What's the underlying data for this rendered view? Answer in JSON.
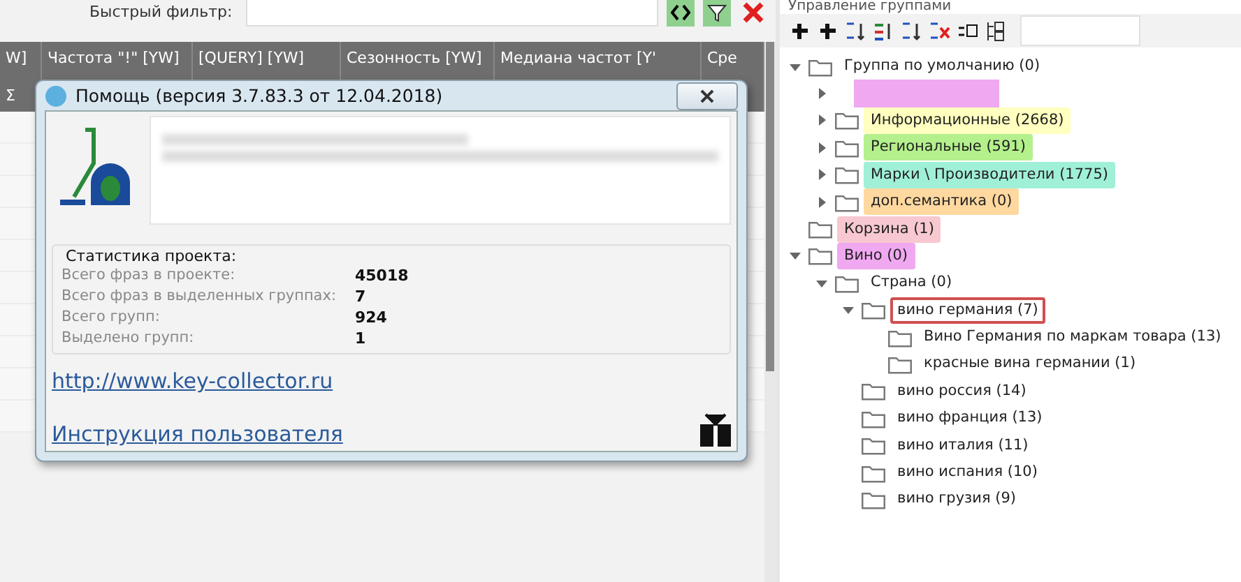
{
  "filter": {
    "label": "Быстрый фильтр:"
  },
  "grid": {
    "columns": [
      "W]",
      "Частота \"!\" [YW]",
      "[QUERY] [YW]",
      "Сезонность [YW]",
      "Медиана частот [Y'",
      "Сре"
    ],
    "sum_symbol": "Σ"
  },
  "dialog": {
    "title": "Помощь (версия 3.7.83.3 от 12.04.2018)",
    "stats_title": "Статистика проекта:",
    "stats": [
      {
        "label": "Всего фраз в проекте:",
        "value": "45018"
      },
      {
        "label": "Всего фраз в выделенных группах:",
        "value": "7"
      },
      {
        "label": "Всего групп:",
        "value": "924"
      },
      {
        "label": "Выделено групп:",
        "value": "1"
      }
    ],
    "links": [
      "http://www.key-collector.ru",
      "Инструкция пользователя"
    ]
  },
  "groups_panel": {
    "title": "Управление группами",
    "tree": [
      {
        "label": "Группа по умолчанию (0)",
        "expanded": true,
        "selected": false,
        "children": [
          {
            "kind": "blurred",
            "expanded": false,
            "selected": false,
            "color": "#f0a8f0"
          },
          {
            "label": "Информационные (2668)",
            "expanded": false,
            "selected": false,
            "color": "#ffffc0"
          },
          {
            "label": "Региональные (591)",
            "expanded": false,
            "selected": false,
            "color": "#b4f08c"
          },
          {
            "label": "Марки \\ Производители (1775)",
            "expanded": false,
            "selected": false,
            "color": "#a0f0d8"
          },
          {
            "label": "доп.семантика (0)",
            "expanded": false,
            "selected": false,
            "color": "#ffd8a0"
          }
        ]
      },
      {
        "label": "Корзина (1)",
        "selected": false,
        "color": "#f8c8d0"
      },
      {
        "label": "Вино (0)",
        "expanded": true,
        "selected": false,
        "color": "#f0a8f0",
        "children": [
          {
            "label": "Страна (0)",
            "expanded": true,
            "selected": false,
            "children": [
              {
                "label": "вино германия (7)",
                "expanded": true,
                "selected": true,
                "children": [
                  {
                    "label": "Вино Германия по маркам товара (13)",
                    "selected": false
                  },
                  {
                    "label": "красные вина германии (1)",
                    "selected": false
                  }
                ]
              },
              {
                "label": "вино россия (14)",
                "selected": false
              },
              {
                "label": "вино франция (13)",
                "selected": false
              },
              {
                "label": "вино италия (11)",
                "selected": false
              },
              {
                "label": "вино испания (10)",
                "selected": false
              },
              {
                "label": "вино грузия (9)",
                "selected": false
              }
            ]
          }
        ]
      }
    ]
  }
}
